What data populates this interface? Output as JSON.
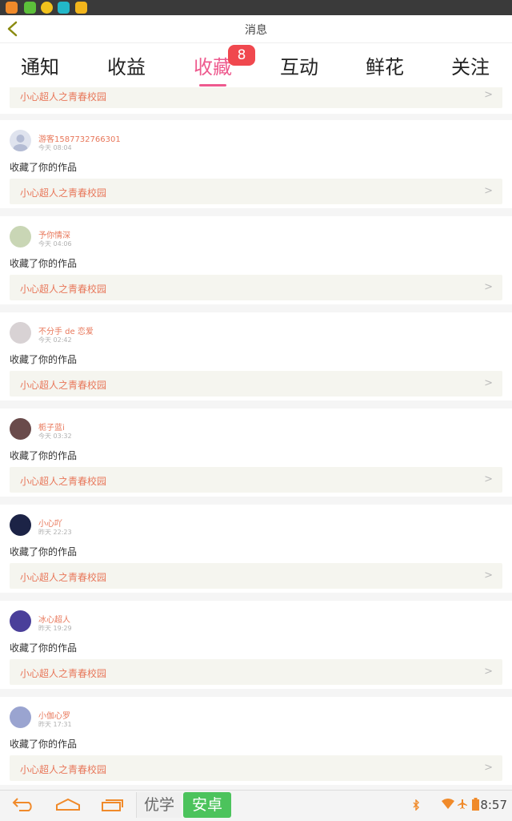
{
  "statusbar": {
    "app_icons": [
      {
        "name": "wechat-icon",
        "color": "#f08a2a"
      },
      {
        "name": "app-green-icon",
        "color": "#5cbf3a"
      },
      {
        "name": "app-yellow-icon",
        "color": "#f2c21c"
      },
      {
        "name": "app-teal-icon",
        "color": "#22b7c8"
      },
      {
        "name": "app-gold-icon",
        "color": "#f2b51c"
      }
    ]
  },
  "header": {
    "title": "消息"
  },
  "tabs": [
    {
      "label": "通知"
    },
    {
      "label": "收益"
    },
    {
      "label": "收藏",
      "active": true,
      "badge": "8"
    },
    {
      "label": "互动"
    },
    {
      "label": "鲜花"
    },
    {
      "label": "关注"
    }
  ],
  "partial_item": {
    "work_title": "小心超人之青春校园"
  },
  "items": [
    {
      "user": "游客1587732766301",
      "time": "今天 08:04",
      "action": "收藏了你的作品",
      "work_title": "小心超人之青春校园"
    },
    {
      "user": "予你情深",
      "time": "今天 04:06",
      "action": "收藏了你的作品",
      "work_title": "小心超人之青春校园"
    },
    {
      "user": "不分手 de 恋爱",
      "time": "今天 02:42",
      "action": "收藏了你的作品",
      "work_title": "小心超人之青春校园"
    },
    {
      "user": "栀子蓝i",
      "time": "今天 03:32",
      "action": "收藏了你的作品",
      "work_title": "小心超人之青春校园"
    },
    {
      "user": "小心吖",
      "time": "昨天 22:23",
      "action": "收藏了你的作品",
      "work_title": "小心超人之青春校园"
    },
    {
      "user": "冰心超人",
      "time": "昨天 19:29",
      "action": "收藏了你的作品",
      "work_title": "小心超人之青春校园"
    },
    {
      "user": "小伽心罗",
      "time": "昨天 17:31",
      "action": "收藏了你的作品",
      "work_title": "小心超人之青春校园"
    }
  ],
  "navbar": {
    "ime_youxue": "优学",
    "ime_anzhuo": "安卓",
    "clock": "8:57"
  },
  "colors": {
    "accent": "#ee5a8e",
    "badge": "#f0484e",
    "name_orange": "#e8775a"
  }
}
